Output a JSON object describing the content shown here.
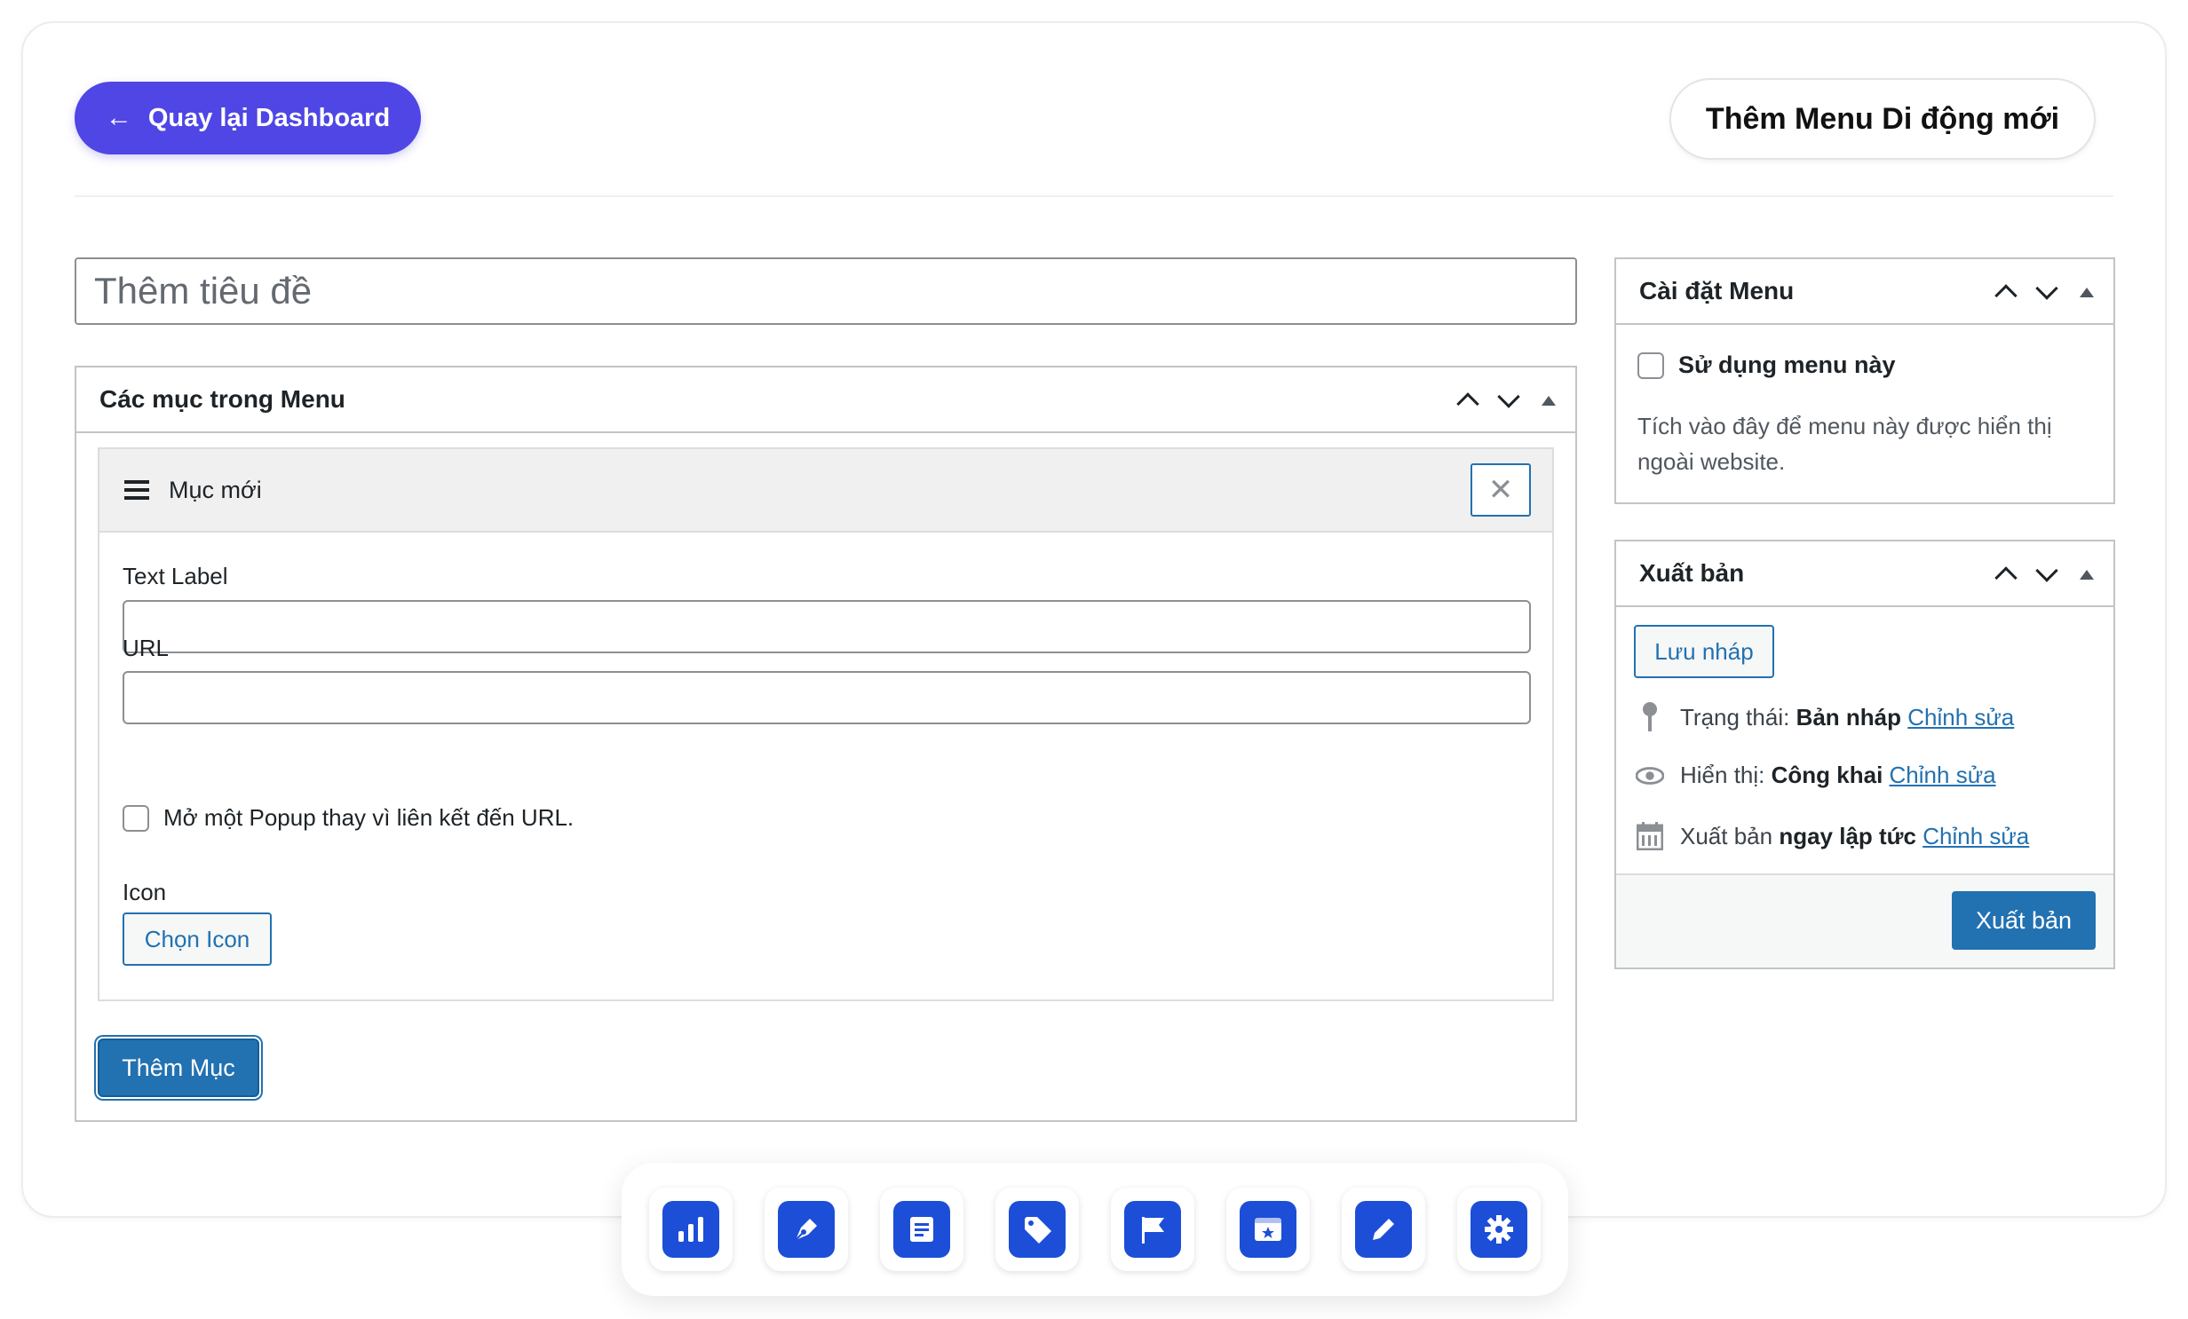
{
  "header": {
    "back_label": "Quay lại Dashboard",
    "new_menu_label": "Thêm Menu Di động mới"
  },
  "title_field": {
    "placeholder": "Thêm tiêu đề",
    "value": ""
  },
  "menu_items_box": {
    "title": "Các mục trong Menu",
    "item": {
      "name": "Mục mới",
      "text_label": "Text Label",
      "text_value": "",
      "url_label": "URL",
      "url_value": "",
      "popup_checkbox_label": "Mở một Popup thay vì liên kết đến URL.",
      "popup_checked": false,
      "icon_label": "Icon",
      "choose_icon_label": "Chọn Icon"
    },
    "add_item_label": "Thêm Mục"
  },
  "menu_settings": {
    "title": "Cài đặt Menu",
    "use_menu_label": "Sử dụng menu này",
    "use_menu_checked": false,
    "description": "Tích vào đây để menu này được hiển thị ngoài website."
  },
  "publish_box": {
    "title": "Xuất bản",
    "save_draft_label": "Lưu nháp",
    "status_prefix": "Trạng thái:",
    "status_value": "Bản nháp",
    "visibility_prefix": "Hiển thị:",
    "visibility_value": "Công khai",
    "schedule_prefix": "Xuất bản",
    "schedule_value": "ngay lập tức",
    "edit_link": "Chỉnh sửa",
    "publish_label": "Xuất bản"
  },
  "dock": {
    "icons": [
      "bar-chart-icon",
      "pen-nib-icon",
      "document-icon",
      "tag-icon",
      "flag-icon",
      "browser-star-icon",
      "pencil-icon",
      "gear-icon"
    ]
  },
  "colors": {
    "accent": "#4f46e5",
    "wp_blue": "#2271b1",
    "dock_icon": "#1d4ed8"
  }
}
